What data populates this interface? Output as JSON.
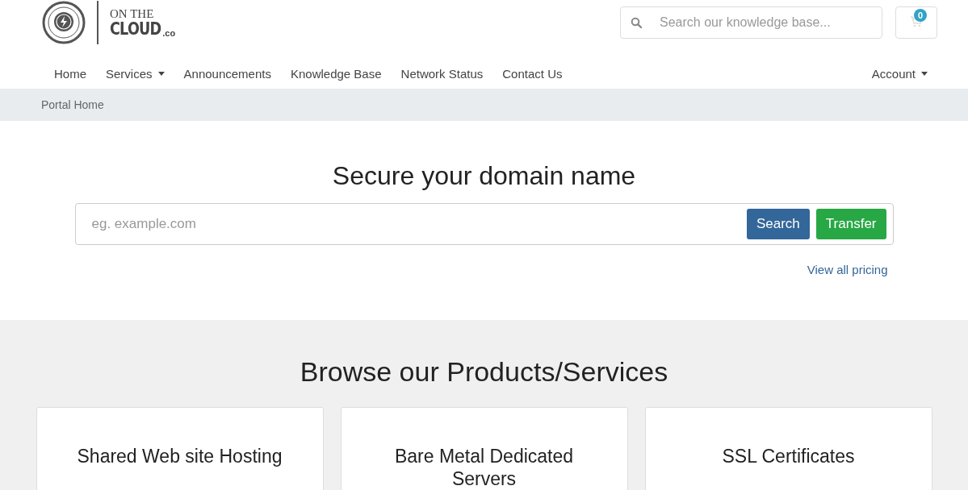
{
  "logo": {
    "line_1": "ON THE",
    "line_2": "CLOUD",
    "suffix": ".co"
  },
  "header_search": {
    "placeholder": "Search our knowledge base..."
  },
  "cart": {
    "count": "0"
  },
  "nav": {
    "items": [
      {
        "label": "Home",
        "dropdown": false
      },
      {
        "label": "Services",
        "dropdown": true
      },
      {
        "label": "Announcements",
        "dropdown": false
      },
      {
        "label": "Knowledge Base",
        "dropdown": false
      },
      {
        "label": "Network Status",
        "dropdown": false
      },
      {
        "label": "Contact Us",
        "dropdown": false
      }
    ],
    "account": {
      "label": "Account",
      "dropdown": true
    }
  },
  "breadcrumb": [
    "Portal Home"
  ],
  "domain": {
    "title": "Secure your domain name",
    "placeholder": "eg. example.com",
    "buttons": [
      {
        "label": "Search",
        "kind": "primary"
      },
      {
        "label": "Transfer",
        "kind": "success"
      }
    ],
    "link": "View all pricing"
  },
  "products": {
    "title": "Browse our Products/Services",
    "cards": [
      {
        "title": "Shared Web site Hosting"
      },
      {
        "title": "Bare Metal Dedicated Servers"
      },
      {
        "title": "SSL Certificates"
      }
    ]
  }
}
